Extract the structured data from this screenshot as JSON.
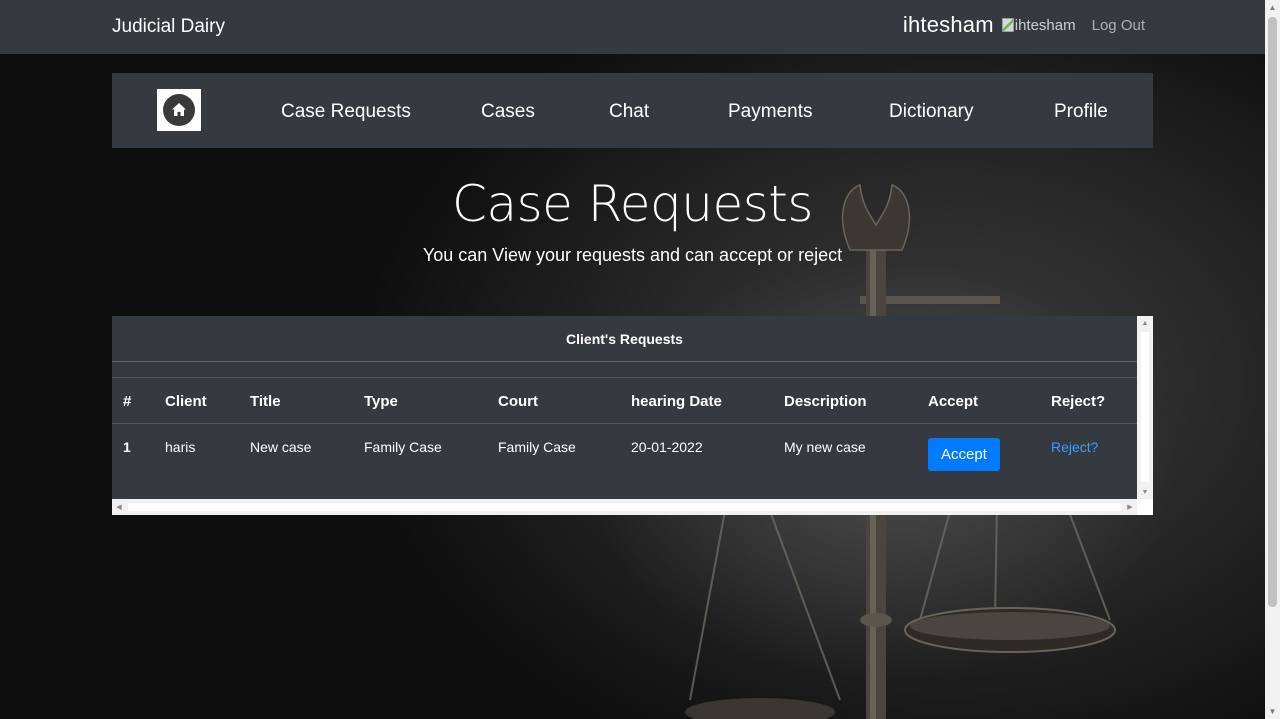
{
  "app": {
    "brand": "Judicial Dairy",
    "user_name": "ihtesham",
    "avatar_alt": "ihtesham",
    "logout_label": "Log Out"
  },
  "nav": {
    "home_icon": "home-icon",
    "items": [
      {
        "label": "Case Requests"
      },
      {
        "label": "Cases"
      },
      {
        "label": "Chat"
      },
      {
        "label": "Payments"
      },
      {
        "label": "Dictionary"
      },
      {
        "label": "Profile"
      }
    ]
  },
  "page": {
    "title": "Case Requests",
    "subtitle": "You can View your requests and can accept or reject"
  },
  "table": {
    "caption": "Client's Requests",
    "headers": [
      "#",
      "Client",
      "Title",
      "Type",
      "Court",
      "hearing Date",
      "Description",
      "Accept",
      "Reject?"
    ],
    "rows": [
      {
        "index": "1",
        "client": "haris",
        "title": "New case",
        "type": "Family Case",
        "court": "Family Case",
        "hearing_date": "20-01-2022",
        "description": "My new case",
        "accept_label": "Accept",
        "reject_label": "Reject?"
      }
    ]
  },
  "colors": {
    "navbar_bg": "#343a40",
    "accept_button": "#007bff",
    "reject_link": "#3d9cff"
  }
}
